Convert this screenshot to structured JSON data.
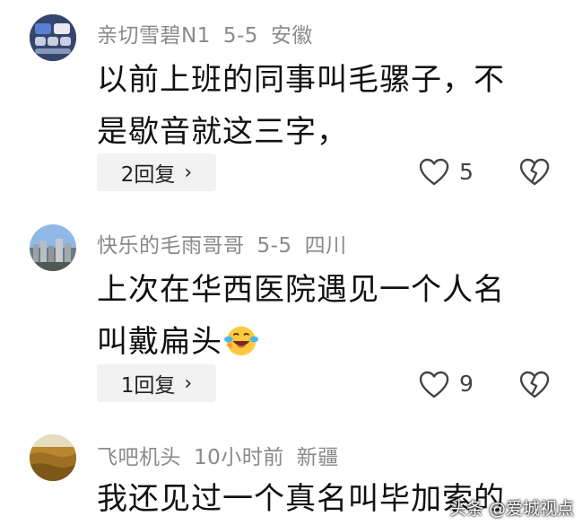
{
  "comments": [
    {
      "username": "亲切雪碧N1",
      "date": "5-5",
      "location": "安徽",
      "text_line1": "以前上班的同事叫毛骡子，不",
      "text_line2": "是歇音就这三字，",
      "reply_label": "2回复",
      "likes": "5",
      "avatar_icon": "phone-screenshot-avatar"
    },
    {
      "username": "快乐的毛雨哥哥",
      "date": "5-5",
      "location": "四川",
      "text_line1": "上次在华西医院遇见一个人名",
      "text_line2": "叫戴扁头",
      "reply_label": "1回复",
      "likes": "9",
      "avatar_icon": "city-skyline-avatar",
      "emoji": "laughing-crying-emoji"
    },
    {
      "username": "飞吧机头",
      "date": "10小时前",
      "location": "新疆",
      "text_line1": "我还见过一个真名叫毕加索的",
      "avatar_icon": "wheat-field-avatar"
    }
  ],
  "watermark": "头条 @爱城视点",
  "icons": {
    "like": "heart-outline-icon",
    "dislike": "broken-heart-icon",
    "chevron": "chevron-right-icon"
  }
}
